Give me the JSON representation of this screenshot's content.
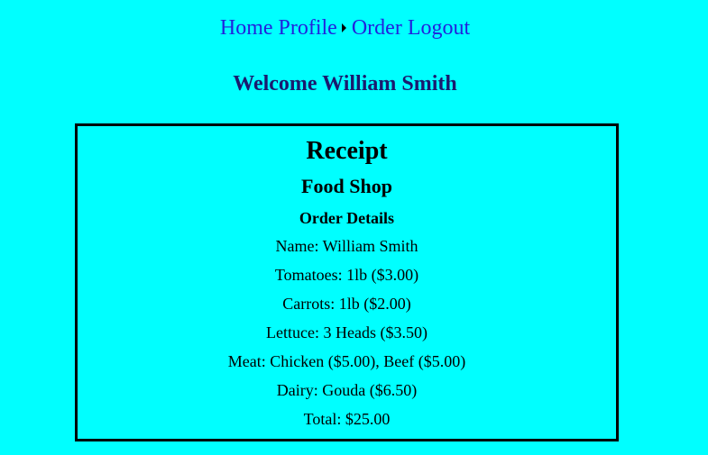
{
  "nav": {
    "home": "Home",
    "profile": "Profile",
    "order": "Order",
    "logout": "Logout"
  },
  "welcome": "Welcome William Smith",
  "receipt": {
    "title": "Receipt",
    "shop": "Food Shop",
    "details_heading": "Order Details",
    "lines": [
      "Name: William Smith",
      "Tomatoes: 1lb ($3.00)",
      "Carrots: 1lb ($2.00)",
      "Lettuce: 3 Heads ($3.50)",
      "Meat: Chicken ($5.00), Beef ($5.00)",
      "Dairy: Gouda ($6.50)",
      "Total: $25.00"
    ]
  },
  "colors": {
    "background": "#00ffff",
    "link": "#2222dd",
    "welcome": "#1a1a6e",
    "border": "#000000"
  }
}
